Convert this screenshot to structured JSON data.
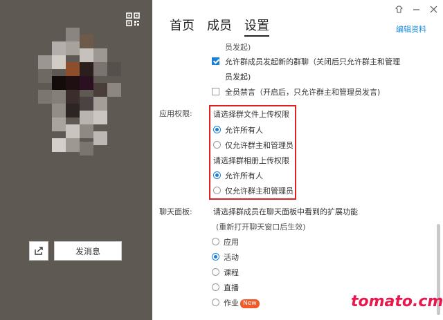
{
  "profile": {
    "send_message_label": "发消息",
    "share_icon": "share-icon",
    "qr_icon": "qr-code-icon"
  },
  "tabs": [
    {
      "label": "首页",
      "active": false
    },
    {
      "label": "成员",
      "active": false
    },
    {
      "label": "设置",
      "active": true
    }
  ],
  "edit_profile_label": "编辑资料",
  "window_controls": {
    "skin": "skin-icon",
    "minimize": "minimize-icon",
    "close": "close-icon"
  },
  "settings": {
    "top_fragment": "员发起)",
    "allow_members_start_chat": {
      "line1": "允许群成员发起新的群聊（关闭后只允许群主和管理",
      "line2": "员发起)",
      "checked": true
    },
    "mute_all": {
      "label": "全员禁言（开启后，只允许群主和管理员发言)",
      "checked": false
    },
    "app_permissions": {
      "label": "应用权限:",
      "file_upload": {
        "title": "请选择群文件上传权限",
        "options": [
          {
            "label": "允许所有人",
            "selected": true
          },
          {
            "label": "仅允许群主和管理员",
            "selected": false
          }
        ]
      },
      "album_upload": {
        "title": "请选择群相册上传权限",
        "options": [
          {
            "label": "允许所有人",
            "selected": true
          },
          {
            "label": "仅允许群主和管理员",
            "selected": false
          }
        ]
      }
    },
    "chat_panel": {
      "label": "聊天面板:",
      "description": "请选择群成员在聊天面板中看到的扩展功能",
      "note": "(重新打开聊天窗口后生效)",
      "options": [
        {
          "label": "应用",
          "selected": false
        },
        {
          "label": "活动",
          "selected": true
        },
        {
          "label": "课程",
          "selected": false
        },
        {
          "label": "直播",
          "selected": false
        },
        {
          "label": "作业",
          "selected": false,
          "badge": "New"
        }
      ]
    }
  },
  "watermark": "tomato.cm",
  "colors": {
    "accent": "#1a7fd6",
    "highlight_box": "#e02020",
    "left_panel": "#5f5954",
    "new_badge": "#f05a28",
    "watermark": "#e8174e"
  }
}
